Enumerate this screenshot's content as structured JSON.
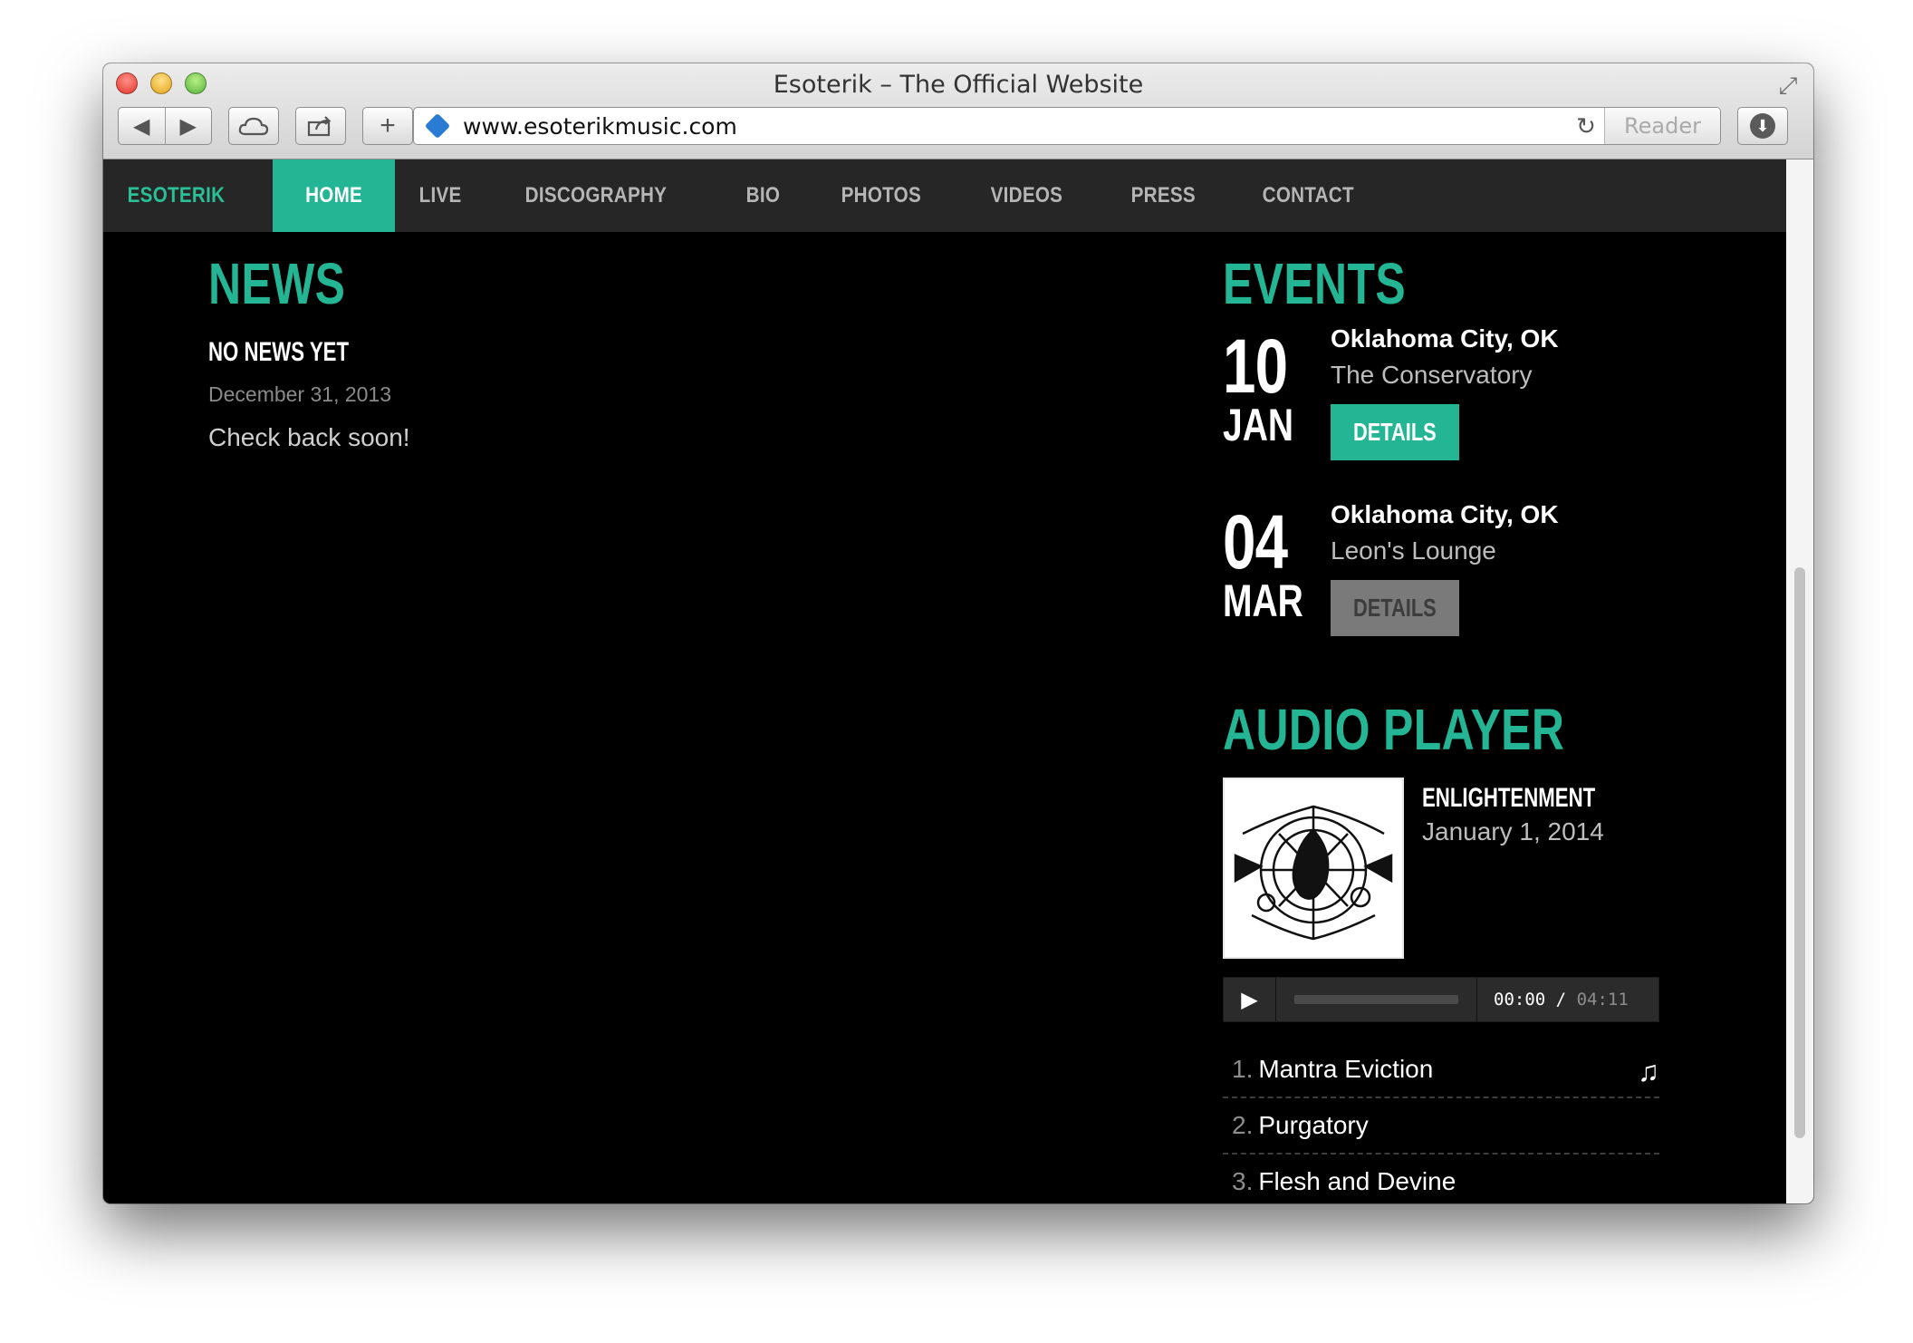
{
  "browser": {
    "title": "Esoterik – The Official Website",
    "url": "www.esoterikmusic.com",
    "reader_label": "Reader",
    "icons": {
      "back": "back-arrow-icon",
      "forward": "forward-arrow-icon",
      "cloud": "cloud-icon",
      "share": "share-icon",
      "add": "plus-icon",
      "reload": "reload-icon",
      "download": "download-icon",
      "fullscreen": "fullscreen-icon"
    }
  },
  "site": {
    "brand": "ESOTERIK",
    "accent_color": "#23b594",
    "nav": [
      {
        "label": "HOME",
        "active": true
      },
      {
        "label": "LIVE"
      },
      {
        "label": "DISCOGRAPHY"
      },
      {
        "label": "BIO"
      },
      {
        "label": "PHOTOS"
      },
      {
        "label": "VIDEOS"
      },
      {
        "label": "PRESS"
      },
      {
        "label": "CONTACT"
      }
    ]
  },
  "news": {
    "heading": "NEWS",
    "post": {
      "title": "NO NEWS YET",
      "date": "December 31, 2013",
      "body": "Check back soon!"
    }
  },
  "events": {
    "heading": "EVENTS",
    "items": [
      {
        "day": "10",
        "month": "JAN",
        "city": "Oklahoma City, OK",
        "venue": "The Conservatory",
        "button": "DETAILS"
      },
      {
        "day": "04",
        "month": "MAR",
        "city": "Oklahoma City, OK",
        "venue": "Leon's Lounge",
        "button": "DETAILS"
      }
    ]
  },
  "audio": {
    "heading": "AUDIO PLAYER",
    "album": {
      "title": "ENLIGHTENMENT",
      "date": "January 1, 2014"
    },
    "player": {
      "current": "00:00",
      "separator": "/",
      "total": "04:11",
      "progress": 0
    },
    "tracks": [
      {
        "num": "1.",
        "name": "Mantra Eviction",
        "playing": true
      },
      {
        "num": "2.",
        "name": "Purgatory"
      },
      {
        "num": "3.",
        "name": "Flesh and Devine"
      }
    ]
  }
}
